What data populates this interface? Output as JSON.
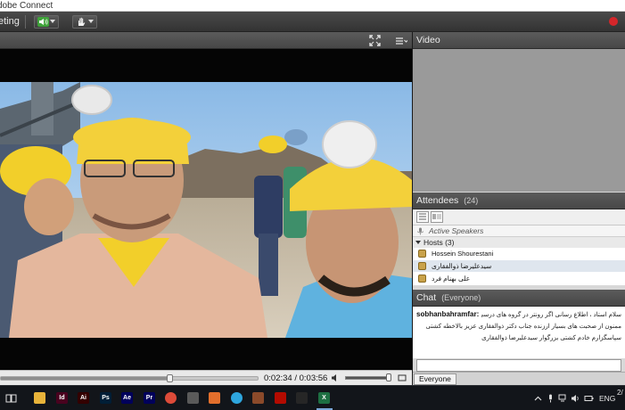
{
  "window": {
    "title": "Adobe Connect",
    "title_visible": "dobe Connect"
  },
  "toolbar": {
    "menu_label": "eting",
    "audio_icon": "speaker-icon",
    "raise_hand_icon": "raise-hand-icon",
    "record_color": "#d4262a"
  },
  "share_pod": {
    "fullscreen_icon": "fullscreen-icon",
    "menu_icon": "pod-menu-icon"
  },
  "player": {
    "current_time": "0:02:34",
    "total_time": "0:03:56",
    "timecode": "0:02:34 / 0:03:56",
    "progress_fraction": 0.652,
    "volume_fraction": 0.95
  },
  "video_pod": {
    "title": "Video"
  },
  "attendees_pod": {
    "title": "Attendees",
    "count": "(24)",
    "active_speakers_label": "Active Speakers",
    "hosts_label": "Hosts (3)",
    "hosts": [
      {
        "name": "Hossein Shourestani"
      },
      {
        "name": "سید‌علیرضا ذوالفقاری"
      },
      {
        "name": "علی بهنام فرد"
      }
    ]
  },
  "chat_pod": {
    "title": "Chat",
    "scope": "(Everyone)",
    "messages": [
      {
        "sender": "sobhanbahramfar:",
        "text": "سلام استاد ، اطلاع رسانی اگر رونتر در گروه های درسی ساعت بهتر میشه"
      },
      {
        "text": "ممنون از صحبت های بسیار ارزنده جناب دکتر ذوالفقاری عزیز بالاخطه کشتی"
      },
      {
        "text": "سپاسگزارم خادم کشتی بزرگوار سید‌علیرضا ذوالفقاری"
      }
    ],
    "recipient_tab": "Everyone"
  },
  "taskbar": {
    "apps": [
      {
        "name": "task-view",
        "glyph": "",
        "color": "#12151a"
      },
      {
        "name": "file-explorer",
        "glyph": "",
        "color": "#e8b33a"
      },
      {
        "name": "indesign",
        "glyph": "Id",
        "color": "#49021f"
      },
      {
        "name": "illustrator",
        "glyph": "Ai",
        "color": "#330000"
      },
      {
        "name": "photoshop",
        "glyph": "Ps",
        "color": "#001e36"
      },
      {
        "name": "after-effects",
        "glyph": "Ae",
        "color": "#00005b"
      },
      {
        "name": "premiere",
        "glyph": "Pr",
        "color": "#00005b"
      },
      {
        "name": "chrome",
        "glyph": "",
        "color": "#dd4b39"
      },
      {
        "name": "app-gray",
        "glyph": "",
        "color": "#5a5a5a"
      },
      {
        "name": "app-orange",
        "glyph": "",
        "color": "#e26f2c"
      },
      {
        "name": "telegram",
        "glyph": "",
        "color": "#2ea6de"
      },
      {
        "name": "app-film",
        "glyph": "",
        "color": "#8b4a2a"
      },
      {
        "name": "acrobat",
        "glyph": "",
        "color": "#b30b00"
      },
      {
        "name": "app-dark",
        "glyph": "",
        "color": "#262626"
      },
      {
        "name": "excel",
        "glyph": "X",
        "color": "#1d6f42"
      }
    ],
    "language": "ENG",
    "date_fragment": "2/"
  }
}
